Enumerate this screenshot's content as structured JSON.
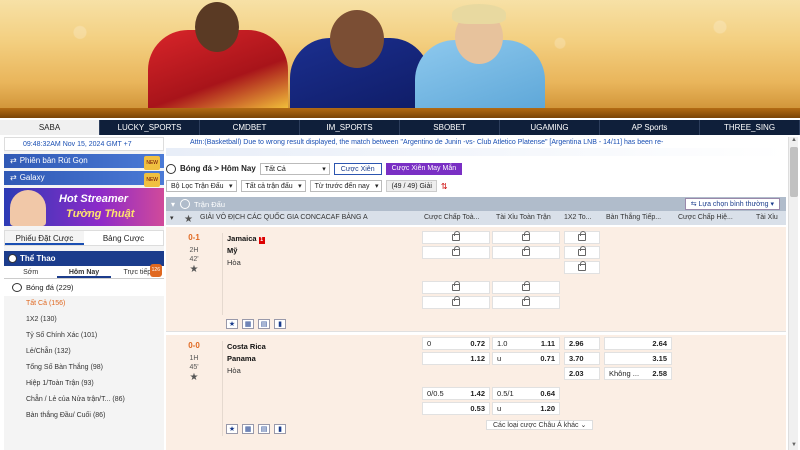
{
  "nav": [
    "SABA",
    "LUCKY_SPORTS",
    "CMDBET",
    "IM_SPORTS",
    "SBOBET",
    "UGAMING",
    "AP Sports",
    "THREE_SING"
  ],
  "left": {
    "time": "09:48:32AM Nov 15, 2024 GMT +7",
    "quick": "Phiên bản Rút Gọn",
    "galaxy": "Galaxy",
    "new": "NEW",
    "promo_line1": "Hot Streamer",
    "promo_line2": "Tường Thuật",
    "tabs": [
      "Phiếu Đặt Cược",
      "Bảng Cược"
    ],
    "sport_header": "Thể Thao",
    "time_tabs": [
      "Sớm",
      "Hôm Nay",
      "Trực tiếp"
    ],
    "live_badge": "126",
    "sport": "Bóng đá",
    "sport_count": "(229)",
    "markets": [
      {
        "label": "Tất Cả",
        "count": "(156)"
      },
      {
        "label": "1X2",
        "count": "(130)"
      },
      {
        "label": "Tỷ Số Chính Xác",
        "count": "(101)"
      },
      {
        "label": "Lẻ/Chẵn",
        "count": "(132)"
      },
      {
        "label": "Tổng Số Bàn Thắng",
        "count": "(98)"
      },
      {
        "label": "Hiệp 1/Toàn Trận",
        "count": "(93)"
      },
      {
        "label": "Chẵn / Lẻ của Nửa trận/T...",
        "count": "(86)"
      },
      {
        "label": "Bàn thắng Đầu/ Cuối",
        "count": "(86)"
      }
    ]
  },
  "main": {
    "marquee": "Attn:(Basketball) Due to wrong result displayed, the match between \"Argentino de Junin -vs- Club Atletico Platense\" [Argentina LNB - 14/11] has been re-",
    "sport_label": "Bóng đá > Hôm Nay",
    "filter_all": "Tất Cả",
    "parlay": "Cược Xiên",
    "lucky_parlay": "Cược Xiên May Mắn",
    "filter_league": "Bộ Lọc Trận Đấu",
    "filter_matches": "Tất cả trận đấu",
    "filter_time": "Từ trước đến nay",
    "count": "(49 / 49) Giải",
    "section": "Trận Đấu",
    "sort": "Lựa chọn bình thường",
    "league": "GIẢI VÔ ĐỊCH CÁC QUỐC GIA CONCACAF BẢNG A",
    "columns": [
      "Cược Chấp Toà...",
      "Tài Xỉu Toàn Trận",
      "1X2 To...",
      "Bàn Thắng Tiếp...",
      "Cược Chấp Hiệ...",
      "Tài Xỉu"
    ],
    "match1": {
      "score": "0-1",
      "period": "2H",
      "minute": "42'",
      "home": "Jamaica",
      "red": "1",
      "away": "Mỹ",
      "draw": "Hòa"
    },
    "match2": {
      "score": "0-0",
      "period": "1H",
      "minute": "45'",
      "home": "Costa Rica",
      "away": "Panama",
      "draw": "Hòa",
      "hdp": [
        {
          "l": "0",
          "r": "0.72"
        },
        {
          "l": "",
          "r": "1.12"
        }
      ],
      "ou": [
        {
          "l": "1.0",
          "r": "1.11"
        },
        {
          "l": "u",
          "r": "0.71"
        }
      ],
      "x12": [
        "2.96",
        "3.70",
        "2.03"
      ],
      "next": [
        {
          "l": "",
          "r": "2.64"
        },
        {
          "l": "",
          "r": "3.15"
        },
        {
          "l": "Không ...",
          "r": "2.58"
        }
      ],
      "hdp2": [
        {
          "l": "0/0.5",
          "r": "1.42"
        },
        {
          "l": "",
          "r": "0.53"
        }
      ],
      "ou2": [
        {
          "l": "0.5/1",
          "r": "0.64"
        },
        {
          "l": "u",
          "r": "1.20"
        }
      ]
    },
    "more": "Các loại cược Châu Á khác"
  }
}
